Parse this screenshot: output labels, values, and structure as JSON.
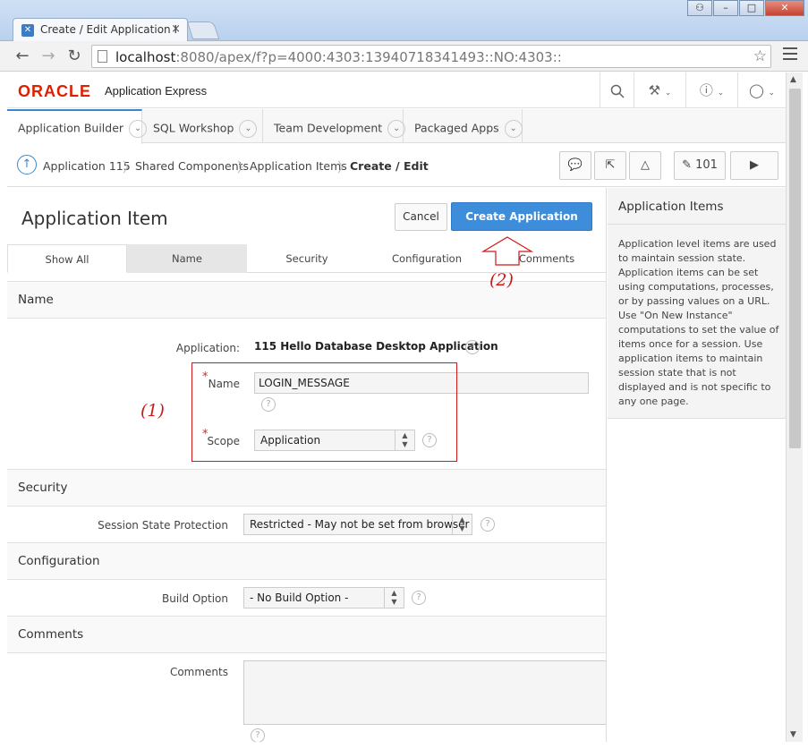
{
  "browser": {
    "tab_title": "Create / Edit Application I",
    "url_host": "localhost",
    "url_rest": ":8080/apex/f?p=4000:4303:13940718341493::NO:4303::"
  },
  "header": {
    "logo": "ORACLE",
    "product": "Application Express"
  },
  "navtabs": [
    {
      "label": "Application Builder"
    },
    {
      "label": "SQL Workshop"
    },
    {
      "label": "Team Development"
    },
    {
      "label": "Packaged Apps"
    }
  ],
  "breadcrumb": {
    "items": [
      "Application 115",
      "Shared Components",
      "Application Items",
      "Create / Edit"
    ],
    "page_number": "101"
  },
  "page": {
    "title": "Application Item",
    "cancel_label": "Cancel",
    "create_label": "Create Application Item",
    "subtabs": [
      "Show All",
      "Name",
      "Security",
      "Configuration",
      "Comments"
    ]
  },
  "sections": {
    "name": {
      "heading": "Name",
      "application_label": "Application:",
      "application_value": "115 Hello Database Desktop Application",
      "name_label": "Name",
      "name_value": "LOGIN_MESSAGE",
      "scope_label": "Scope",
      "scope_value": "Application"
    },
    "security": {
      "heading": "Security",
      "ssp_label": "Session State Protection",
      "ssp_value": "Restricted - May not be set from browser"
    },
    "configuration": {
      "heading": "Configuration",
      "build_label": "Build Option",
      "build_value": "- No Build Option -"
    },
    "comments": {
      "heading": "Comments",
      "comments_label": "Comments"
    }
  },
  "help_panel": {
    "title": "Application Items",
    "body": "Application level items are used to maintain session state. Application items can be set using computations, processes, or by passing values on a URL. Use \"On New Instance\" computations to set the value of items once for a session. Use application items to maintain session state that is not displayed and is not specific to any one page."
  },
  "annotations": {
    "one": "(1)",
    "two": "(2)"
  },
  "colors": {
    "primary_button": "#3d8ddb",
    "oracle_red": "#e01e00",
    "annotation_red": "#d01818"
  }
}
